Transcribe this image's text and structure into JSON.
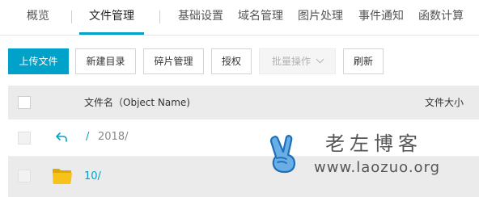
{
  "tabs": [
    {
      "label": "概览"
    },
    {
      "label": "文件管理"
    },
    {
      "label": "基础设置"
    },
    {
      "label": "域名管理"
    },
    {
      "label": "图片处理"
    },
    {
      "label": "事件通知"
    },
    {
      "label": "函数计算"
    }
  ],
  "toolbar": {
    "upload": "上传文件",
    "new_dir": "新建目录",
    "fragments": "碎片管理",
    "authorize": "授权",
    "batch": "批量操作",
    "refresh": "刷新"
  },
  "table": {
    "columns": {
      "name": "文件名（Object Name)",
      "size": "文件大小"
    },
    "rows": [
      {
        "back_icon": "back-arrow-icon",
        "link": "/",
        "path": "2018/"
      },
      {
        "folder_icon": "folder-icon",
        "name": "10/"
      }
    ]
  },
  "watermark": {
    "title": "老左博客",
    "url": "www.laozuo.org"
  },
  "colors": {
    "accent": "#00a2ca",
    "folder": "#f7c21a",
    "header_bg": "#ebebeb"
  }
}
